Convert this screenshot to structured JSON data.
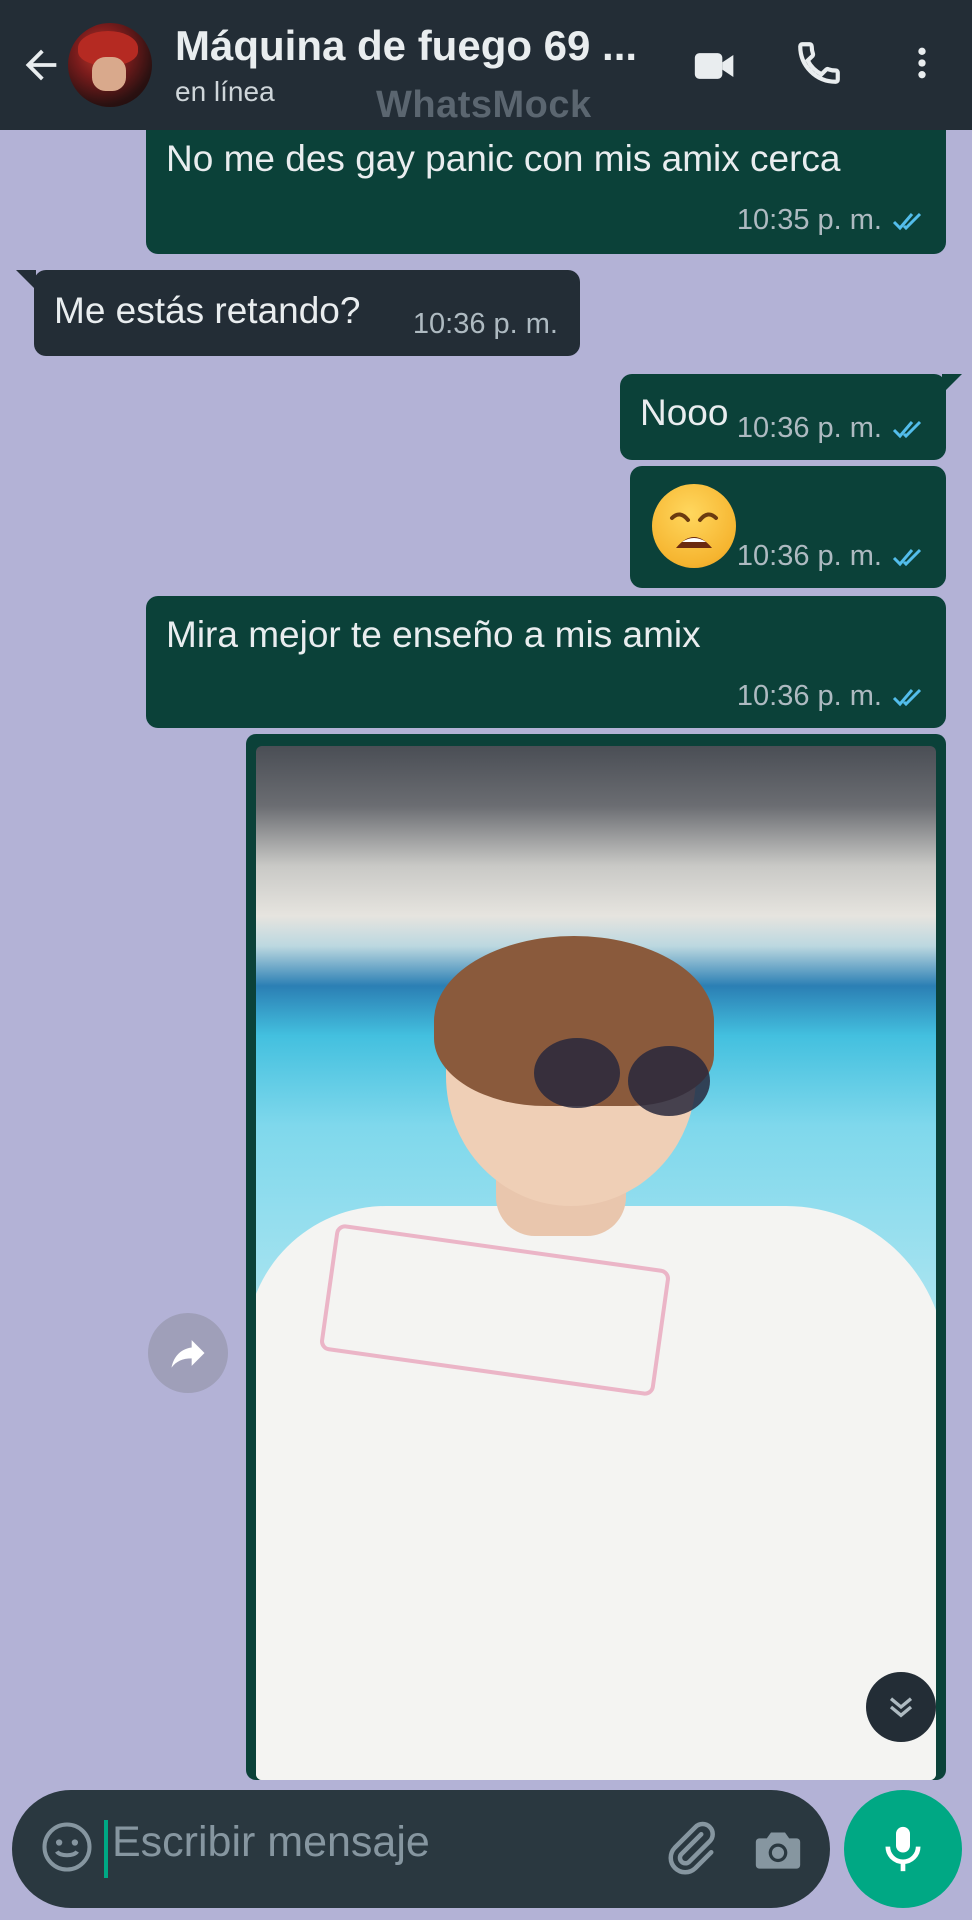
{
  "header": {
    "contact_name": "Máquina de fuego 69 ...",
    "status": "en línea",
    "watermark": "WhatsMock"
  },
  "messages": [
    {
      "direction": "outgoing",
      "text": "No me des gay panic con mis amix cerca",
      "time": "10:35 p. m.",
      "read": true
    },
    {
      "direction": "incoming",
      "text": "Me estás retando?",
      "time": "10:36 p. m."
    },
    {
      "direction": "outgoing",
      "text": "Nooo",
      "time": "10:36 p. m.",
      "read": true
    },
    {
      "direction": "outgoing",
      "emoji": "weary-face",
      "time": "10:36 p. m.",
      "read": true
    },
    {
      "direction": "outgoing",
      "text": "Mira mejor te enseño a mis amix",
      "time": "10:36 p. m.",
      "read": true
    },
    {
      "direction": "outgoing",
      "type": "image"
    }
  ],
  "compose": {
    "placeholder": "Escribir mensaje"
  },
  "colors": {
    "chat_background": "#b3b2d6",
    "header": "#232d36",
    "outgoing_bubble": "#0b4139",
    "incoming_bubble": "#232d36",
    "read_ticks": "#53bdeb",
    "accent": "#00a884"
  },
  "icons": [
    "back-arrow-icon",
    "video-call-icon",
    "phone-icon",
    "more-options-icon",
    "forward-icon",
    "scroll-down-icon",
    "smiley-icon",
    "attach-icon",
    "camera-icon",
    "mic-icon"
  ]
}
